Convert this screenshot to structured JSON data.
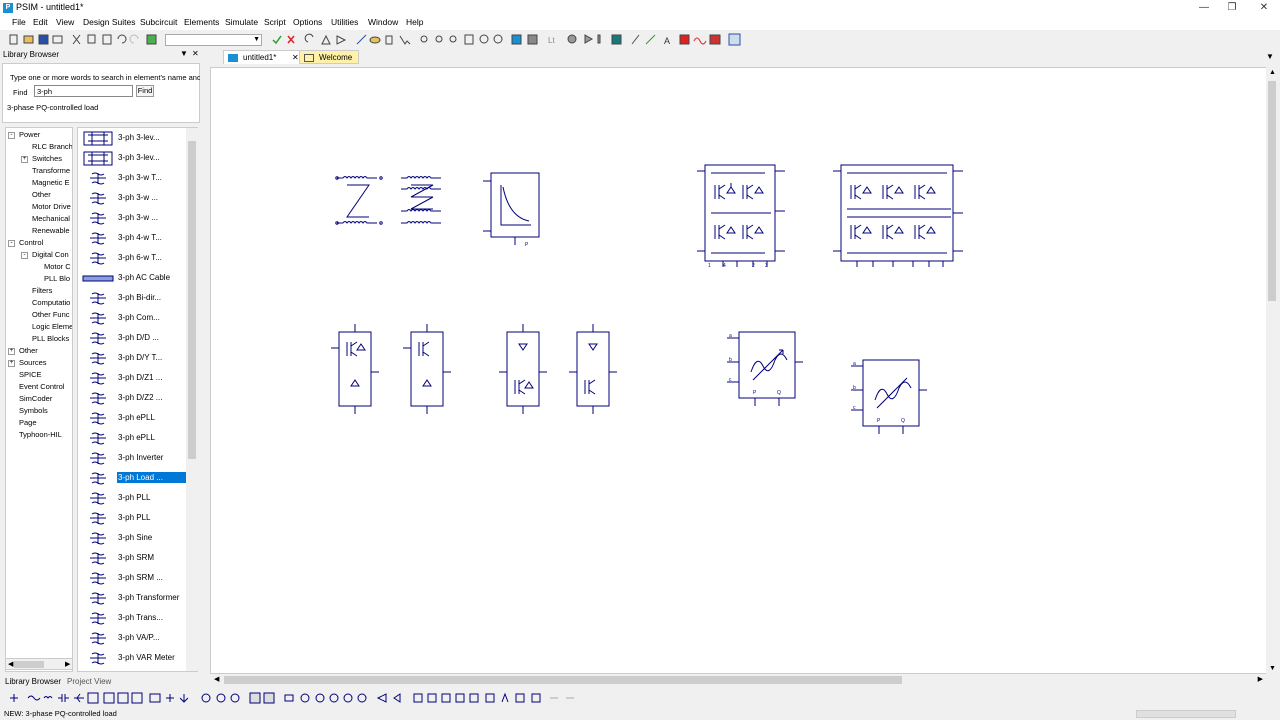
{
  "window": {
    "title": "PSIM - untitled1*",
    "icon_name": "psim-app-icon",
    "app_icon_letter": "P"
  },
  "menu": [
    "File",
    "Edit",
    "View",
    "Design Suites",
    "Subcircuit",
    "Elements",
    "Simulate",
    "Script",
    "Options",
    "Utilities",
    "Window",
    "Help"
  ],
  "library": {
    "header": "Library Browser",
    "hint": "Type one or more words to search in element's name and d",
    "find_label": "Find",
    "find_value": "3-ph",
    "find_button": "Find",
    "selected_description": "3-phase PQ-controlled load",
    "tree": [
      {
        "label": "Power",
        "level": 0,
        "expander": "-"
      },
      {
        "label": "RLC Branch",
        "level": 1
      },
      {
        "label": "Switches",
        "level": 1,
        "expander": "+"
      },
      {
        "label": "Transforme",
        "level": 1
      },
      {
        "label": "Magnetic E",
        "level": 1
      },
      {
        "label": "Other",
        "level": 1
      },
      {
        "label": "Motor Drive",
        "level": 1
      },
      {
        "label": "Mechanical",
        "level": 1
      },
      {
        "label": "Renewable",
        "level": 1
      },
      {
        "label": "Control",
        "level": 0,
        "expander": "-"
      },
      {
        "label": "Digital Con",
        "level": 1,
        "expander": "-"
      },
      {
        "label": "Motor C",
        "level": 2
      },
      {
        "label": "PLL Blo",
        "level": 2
      },
      {
        "label": "Filters",
        "level": 1
      },
      {
        "label": "Computatio",
        "level": 1
      },
      {
        "label": "Other Func",
        "level": 1
      },
      {
        "label": "Logic Eleme",
        "level": 1
      },
      {
        "label": "PLL Blocks",
        "level": 1
      },
      {
        "label": "Other",
        "level": 0,
        "expander": "+"
      },
      {
        "label": "Sources",
        "level": 0,
        "expander": "+"
      },
      {
        "label": "SPICE",
        "level": 0
      },
      {
        "label": "Event Control",
        "level": 0
      },
      {
        "label": "SimCoder",
        "level": 0
      },
      {
        "label": "Symbols",
        "level": 0
      },
      {
        "label": "Page",
        "level": 0
      },
      {
        "label": "Typhoon-HIL",
        "level": 0
      }
    ],
    "elements": [
      {
        "label": "3-ph 3-lev...",
        "icon": "three-level-bridge-icon"
      },
      {
        "label": "3-ph 3-lev...",
        "icon": "three-level-bridge-icon"
      },
      {
        "label": "3-ph 3-w T...",
        "icon": "three-winding-transformer-icon"
      },
      {
        "label": "3-ph 3-w ...",
        "icon": "three-winding-transformer-icon"
      },
      {
        "label": "3-ph 3-w ...",
        "icon": "three-winding-transformer-icon"
      },
      {
        "label": "3-ph 4-w T...",
        "icon": "four-winding-transformer-icon"
      },
      {
        "label": "3-ph 6-w T...",
        "icon": "six-winding-transformer-icon"
      },
      {
        "label": "3-ph AC Cable",
        "icon": "ac-cable-icon"
      },
      {
        "label": "3-ph Bi-dir...",
        "icon": "bidirectional-switch-icon"
      },
      {
        "label": "3-ph Com...",
        "icon": "coupled-inductor-icon"
      },
      {
        "label": "3-ph D/D ...",
        "icon": "delta-delta-transformer-icon"
      },
      {
        "label": "3-ph D/Y T...",
        "icon": "delta-wye-transformer-icon"
      },
      {
        "label": "3-ph D/Z1 ...",
        "icon": "delta-zigzag-transformer-icon"
      },
      {
        "label": "3-ph D/Z2 ...",
        "icon": "delta-zigzag-transformer-icon"
      },
      {
        "label": "3-ph ePLL",
        "icon": "epll-icon"
      },
      {
        "label": "3-ph ePLL",
        "icon": "epll-icon"
      },
      {
        "label": "3-ph Inverter",
        "icon": "inverter-icon"
      },
      {
        "label": "3-ph Load ...",
        "icon": "pq-load-icon",
        "selected": true
      },
      {
        "label": "3-ph PLL",
        "icon": "pll-icon"
      },
      {
        "label": "3-ph PLL",
        "icon": "pll-icon"
      },
      {
        "label": "3-ph Sine",
        "icon": "sine-source-icon"
      },
      {
        "label": "3-ph SRM",
        "icon": "srm-icon"
      },
      {
        "label": "3-ph SRM ...",
        "icon": "srm-icon"
      },
      {
        "label": "3-ph Transformer",
        "icon": "transformer-icon"
      },
      {
        "label": "3-ph Trans...",
        "icon": "transformer-icon"
      },
      {
        "label": "3-ph VA/P...",
        "icon": "va-meter-icon"
      },
      {
        "label": "3-ph VAR Meter",
        "icon": "var-meter-icon"
      }
    ]
  },
  "bottom_tabs": [
    "Library Browser",
    "Project View"
  ],
  "doc_tabs": [
    {
      "label": "untitled1*",
      "active": true
    },
    {
      "label": "Welcome",
      "active": false
    }
  ],
  "canvas": {
    "load_labels": {
      "a": "a",
      "b": "b",
      "c": "c",
      "p": "P",
      "q": "Q"
    },
    "curve_block_label": "P",
    "bridge_port_labels": [
      "1",
      "4",
      "2",
      "3"
    ]
  },
  "status": "NEW: 3-phase PQ-controlled load",
  "colors": {
    "accent": "#0078d7",
    "schematic": "#00007a",
    "tab_highlight": "#fff2a8"
  }
}
